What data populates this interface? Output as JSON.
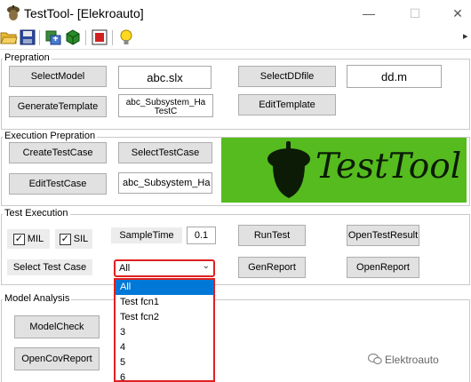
{
  "window": {
    "title": "TestTool- [Elekroauto]",
    "minimize": "—",
    "maximize": "☐",
    "close": "✕",
    "toolbar_overflow": "▸"
  },
  "toolbar": {
    "icons": [
      "open-folder-icon",
      "save-icon",
      "import-icon",
      "cube-icon",
      "stop-icon",
      "lightbulb-icon"
    ]
  },
  "preparation": {
    "group_label": "Prepration",
    "select_model": "SelectModel",
    "model_file": "abc.slx",
    "select_dd": "SelectDDfile",
    "dd_file": "dd.m",
    "generate_template": "GenerateTemplate",
    "template_file": "abc_Subsystem_Ha",
    "template_file_cut": "TestC",
    "edit_template": "EditTemplate"
  },
  "execution_preparation": {
    "group_label": "Execution Prepration",
    "create_test_case": "CreateTestCase",
    "select_test_case": "SelectTestCase",
    "edit_test_case": "EditTestCase",
    "test_case_file": "abc_Subsystem_Ha",
    "logo_text": "TestTool"
  },
  "test_execution": {
    "group_label": "Test Execution",
    "mil_label": "MIL",
    "mil_checked": true,
    "sil_label": "SIL",
    "sil_checked": true,
    "sample_time_label": "SampleTime",
    "sample_time_value": "0.1",
    "run_test": "RunTest",
    "open_test_result": "OpenTestResult",
    "select_test_case_label": "Select Test Case",
    "select_value": "All",
    "gen_report": "GenReport",
    "open_report": "OpenReport",
    "options": [
      "All",
      "Test fcn1",
      "Test fcn2",
      "3",
      "4",
      "5",
      "6"
    ],
    "selected_index": 0
  },
  "model_analysis": {
    "group_label": "Model Analysis",
    "model_check": "ModelCheck",
    "open_cov_report": "OpenCovReport"
  },
  "watermark": {
    "text": "Elektroauto"
  },
  "colors": {
    "logo_background": "#55bb1f",
    "selection": "#0078d7",
    "highlight_border": "#e02020"
  }
}
